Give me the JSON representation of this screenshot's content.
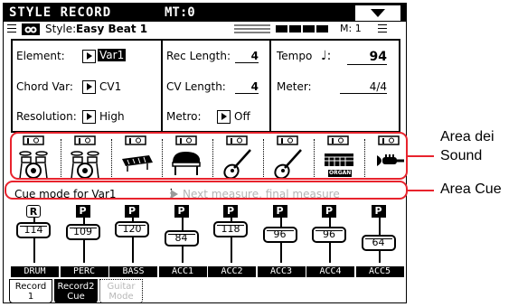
{
  "header": {
    "title": "STYLE RECORD",
    "mt": "MT:0"
  },
  "style_row": {
    "label": "Style:",
    "name": "Easy Beat 1",
    "measure": "M: 1"
  },
  "params": {
    "element_label": "Element:",
    "element_value": "Var1",
    "chordvar_label": "Chord Var:",
    "chordvar_value": "CV1",
    "resolution_label": "Resolution:",
    "resolution_value": "High",
    "reclength_label": "Rec Length:",
    "reclength_value": "4",
    "cvlength_label": "CV Length:",
    "cvlength_value": "4",
    "metro_label": "Metro:",
    "metro_value": "Off",
    "tempo_label": "Tempo",
    "tempo_symbol": "♩:",
    "tempo_value": "94",
    "meter_label": "Meter:",
    "meter_value": "4/4"
  },
  "sounds": [
    {
      "icon": "drum-kit-icon"
    },
    {
      "icon": "drum-kit-icon"
    },
    {
      "icon": "bass-keyboard-icon"
    },
    {
      "icon": "grand-piano-icon"
    },
    {
      "icon": "acoustic-guitar-icon"
    },
    {
      "icon": "acoustic-guitar-icon"
    },
    {
      "icon": "organ-icon",
      "caption": "ORGAN"
    },
    {
      "icon": "brass-horn-icon"
    }
  ],
  "cue": {
    "label": "Cue mode for Var1",
    "value": "Next measure, final measure"
  },
  "tracks": [
    {
      "mode": "R",
      "value": "114",
      "name": "DRUM",
      "level": 0.9
    },
    {
      "mode": "P",
      "value": "109",
      "name": "PERC",
      "level": 0.86
    },
    {
      "mode": "P",
      "value": "120",
      "name": "BASS",
      "level": 0.94
    },
    {
      "mode": "P",
      "value": "84",
      "name": "ACC1",
      "level": 0.66
    },
    {
      "mode": "P",
      "value": "118",
      "name": "ACC2",
      "level": 0.93
    },
    {
      "mode": "P",
      "value": "96",
      "name": "ACC3",
      "level": 0.76
    },
    {
      "mode": "P",
      "value": "96",
      "name": "ACC4",
      "level": 0.76
    },
    {
      "mode": "P",
      "value": "64",
      "name": "ACC5",
      "level": 0.5
    }
  ],
  "tabs": [
    {
      "line1": "Record",
      "line2": "1",
      "state": "normal"
    },
    {
      "line1": "Record2",
      "line2": "Cue",
      "state": "active"
    },
    {
      "line1": "Guitar",
      "line2": "Mode",
      "state": "disabled"
    }
  ],
  "annotations": {
    "sound_area_line1": "Area dei",
    "sound_area_line2": "Sound",
    "cue_area": "Area Cue"
  },
  "colors": {
    "callout": "#e8232d"
  }
}
